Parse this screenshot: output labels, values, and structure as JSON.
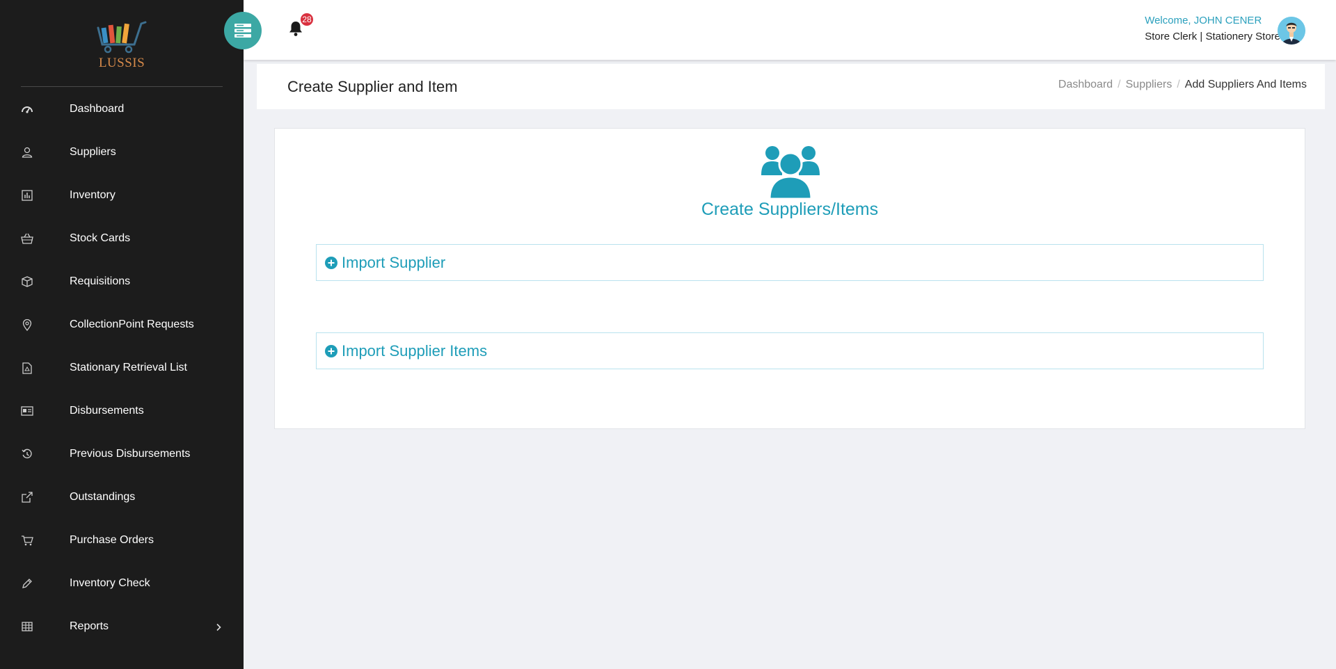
{
  "app": {
    "logo_text": "LUSSIS"
  },
  "sidebar": {
    "items": [
      {
        "label": "Dashboard",
        "icon": "dashboard-gauge-icon"
      },
      {
        "label": "Suppliers",
        "icon": "user-icon"
      },
      {
        "label": "Inventory",
        "icon": "chart-box-icon"
      },
      {
        "label": "Stock Cards",
        "icon": "basket-icon"
      },
      {
        "label": "Requisitions",
        "icon": "box-icon"
      },
      {
        "label": "CollectionPoint Requests",
        "icon": "map-pin-icon"
      },
      {
        "label": "Stationary Retrieval List",
        "icon": "pdf-file-icon"
      },
      {
        "label": "Disbursements",
        "icon": "id-card-icon"
      },
      {
        "label": "Previous Disbursements",
        "icon": "history-icon"
      },
      {
        "label": "Outstandings",
        "icon": "external-link-icon"
      },
      {
        "label": "Purchase Orders",
        "icon": "cart-icon"
      },
      {
        "label": "Inventory Check",
        "icon": "pencil-icon"
      },
      {
        "label": "Reports",
        "icon": "table-icon",
        "has_submenu": true
      }
    ]
  },
  "header": {
    "notification_count": "28",
    "welcome_text": "Welcome, JOHN CENER",
    "user_role": "Store Clerk | Stationery Store"
  },
  "page": {
    "title": "Create Supplier and Item",
    "breadcrumb": [
      "Dashboard",
      "Suppliers",
      "Add Suppliers And Items"
    ]
  },
  "card": {
    "title": "Create Suppliers/Items",
    "panels": [
      {
        "label": "Import Supplier"
      },
      {
        "label": "Import Supplier Items"
      }
    ]
  },
  "colors": {
    "sidebar_bg": "#1c1c1c",
    "accent": "#1e9db8",
    "menu_button": "#3ca8a4",
    "badge": "#d9313f"
  }
}
